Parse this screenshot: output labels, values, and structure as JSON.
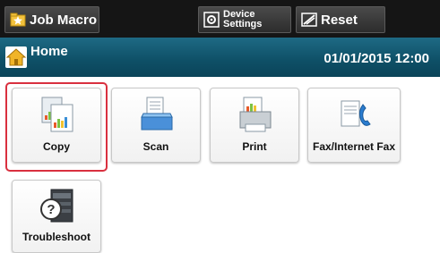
{
  "toolbar": {
    "job_macro_label": "Job Macro",
    "device_settings_line1": "Device",
    "device_settings_line2": "Settings",
    "reset_label": "Reset"
  },
  "header": {
    "title": "Home",
    "datetime": "01/01/2015 12:00"
  },
  "tiles": [
    {
      "label": "Copy",
      "icon": "copy-icon",
      "selected": true
    },
    {
      "label": "Scan",
      "icon": "scan-icon",
      "selected": false
    },
    {
      "label": "Print",
      "icon": "print-icon",
      "selected": false
    },
    {
      "label": "Fax/Internet Fax",
      "icon": "fax-icon",
      "selected": false
    },
    {
      "label": "Troubleshoot",
      "icon": "troubleshoot-icon",
      "selected": false
    }
  ],
  "colors": {
    "header_bg": "#0e4f66",
    "selection": "#d9303f",
    "toolbar_bg": "#151515"
  }
}
